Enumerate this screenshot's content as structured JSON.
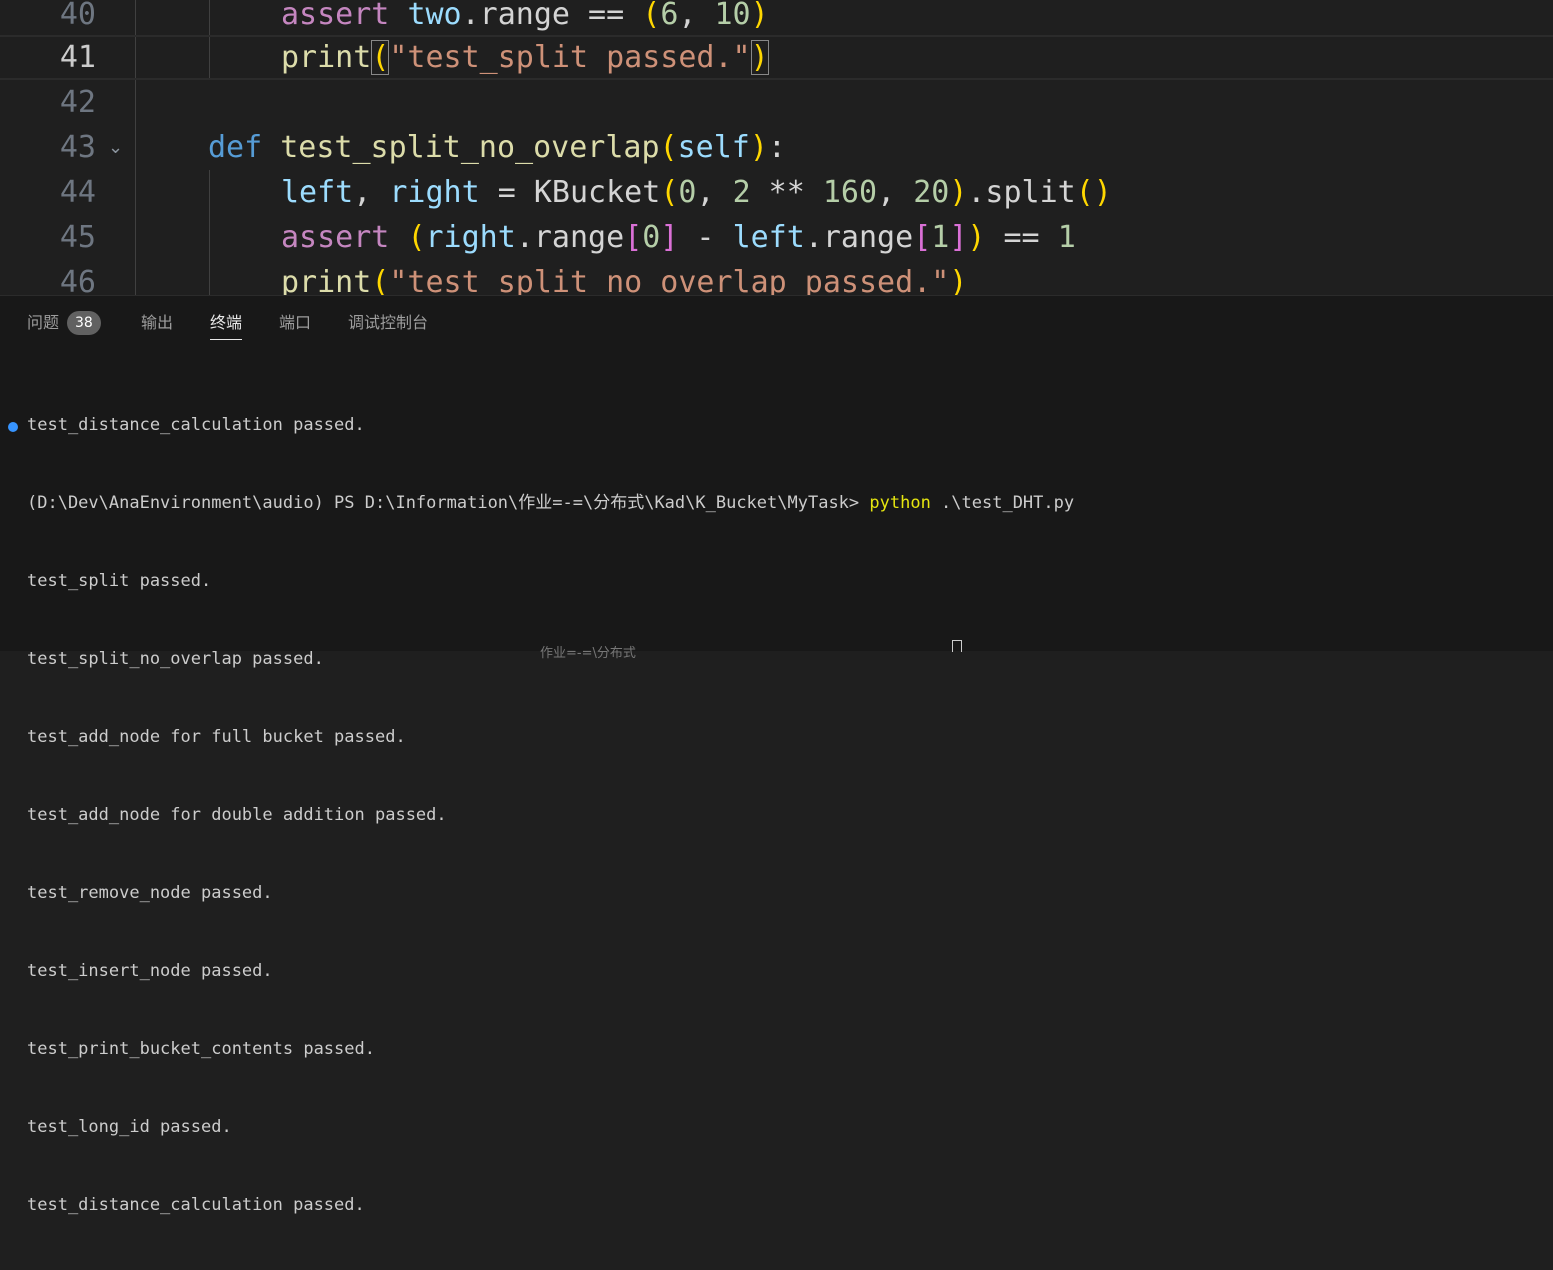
{
  "editor": {
    "lines": [
      {
        "num": "40",
        "tokens": [
          [
            "kw-ctl",
            "assert"
          ],
          [
            "op",
            " "
          ],
          [
            "var",
            "two"
          ],
          [
            "op",
            ".range == "
          ],
          [
            "b1",
            "("
          ],
          [
            "num",
            "6"
          ],
          [
            "op",
            ", "
          ],
          [
            "num",
            "10"
          ],
          [
            "b1",
            ")"
          ]
        ]
      },
      {
        "num": "41",
        "tokens": [
          [
            "fn",
            "print"
          ],
          [
            "b1 match",
            "("
          ],
          [
            "str",
            "\"test_split passed.\""
          ],
          [
            "b1 match",
            ")"
          ]
        ]
      },
      {
        "num": "42",
        "tokens": []
      },
      {
        "num": "43",
        "tokens": [
          [
            "kw",
            "def"
          ],
          [
            "op",
            " "
          ],
          [
            "fn",
            "test_split_no_overlap"
          ],
          [
            "b1",
            "("
          ],
          [
            "var",
            "self"
          ],
          [
            "b1",
            ")"
          ],
          [
            "op",
            ":"
          ]
        ]
      },
      {
        "num": "44",
        "tokens": [
          [
            "var",
            "left"
          ],
          [
            "op",
            ", "
          ],
          [
            "var",
            "right"
          ],
          [
            "op",
            " = KBucket"
          ],
          [
            "b1",
            "("
          ],
          [
            "num",
            "0"
          ],
          [
            "op",
            ", "
          ],
          [
            "num",
            "2"
          ],
          [
            "op",
            " ** "
          ],
          [
            "num",
            "160"
          ],
          [
            "op",
            ", "
          ],
          [
            "num",
            "20"
          ],
          [
            "b1",
            ")"
          ],
          [
            "op",
            ".split"
          ],
          [
            "b1",
            "()"
          ]
        ]
      },
      {
        "num": "45",
        "tokens": [
          [
            "kw-ctl",
            "assert"
          ],
          [
            "op",
            " "
          ],
          [
            "b1",
            "("
          ],
          [
            "var",
            "right"
          ],
          [
            "op",
            ".range"
          ],
          [
            "b2",
            "["
          ],
          [
            "num",
            "0"
          ],
          [
            "b2",
            "]"
          ],
          [
            "op",
            " - "
          ],
          [
            "var",
            "left"
          ],
          [
            "op",
            ".range"
          ],
          [
            "b2",
            "["
          ],
          [
            "num",
            "1"
          ],
          [
            "b2",
            "]"
          ],
          [
            "b1",
            ")"
          ],
          [
            "op",
            " == "
          ],
          [
            "num",
            "1"
          ]
        ]
      },
      {
        "num": "46",
        "tokens": [
          [
            "fn",
            "print"
          ],
          [
            "b1",
            "("
          ],
          [
            "str",
            "\"test_split_no_overlap passed.\""
          ],
          [
            "b1",
            ")"
          ]
        ]
      }
    ]
  },
  "panel": {
    "tabs": {
      "problems": "问题",
      "problems_count": "38",
      "output": "输出",
      "terminal": "终端",
      "ports": "端口",
      "debug_console": "调试控制台"
    },
    "terminal": {
      "line0": "test_distance_calculation passed.",
      "prompt": "(D:\\Dev\\AnaEnvironment\\audio) PS D:\\Information\\作业=-=\\分布式\\Kad\\K_Bucket\\MyTask> ",
      "command": "python",
      "args": " .\\test_DHT.py",
      "output": [
        "test_split passed.",
        "test_split_no_overlap passed.",
        "test_add_node for full bucket passed.",
        "test_add_node for double addition passed.",
        "test_remove_node passed.",
        "test_insert_node passed.",
        "test_print_bucket_contents passed.",
        "test_long_id passed.",
        "test_distance_calculation passed."
      ],
      "cutoff_text": "作业=-=\\分布式"
    }
  }
}
